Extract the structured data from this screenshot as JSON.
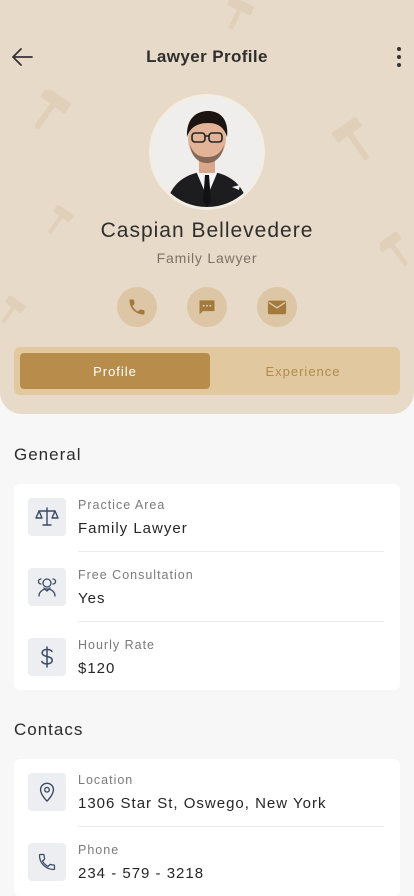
{
  "colors": {
    "hero_bg": "#e7dac8",
    "accent": "#b88d4c",
    "accent_light": "#e2c89f",
    "icon_box_bg": "#eceef2",
    "icon_color": "#3b4a66"
  },
  "header": {
    "title": "Lawyer Profile",
    "back_icon": "arrow-left-icon",
    "menu_icon": "more-vertical-icon"
  },
  "profile": {
    "name": "Caspian Bellevedere",
    "role": "Family Lawyer",
    "actions": [
      {
        "icon": "phone-icon"
      },
      {
        "icon": "message-icon"
      },
      {
        "icon": "mail-icon"
      }
    ]
  },
  "tabs": [
    {
      "label": "Profile",
      "active": true
    },
    {
      "label": "Experience",
      "active": false
    }
  ],
  "general": {
    "title": "General",
    "items": [
      {
        "label": "Practice Area",
        "value": "Family Lawyer",
        "icon": "scales-icon"
      },
      {
        "label": "Free Consultation",
        "value": "Yes",
        "icon": "consultation-icon"
      },
      {
        "label": "Hourly Rate",
        "value": "$120",
        "icon": "dollar-icon"
      }
    ]
  },
  "contacts": {
    "title": "Contacs",
    "items": [
      {
        "label": "Location",
        "value": "1306 Star St, Oswego, New York",
        "icon": "location-pin-icon"
      },
      {
        "label": "Phone",
        "value": "234 - 579 - 3218",
        "icon": "phone-icon"
      }
    ]
  }
}
